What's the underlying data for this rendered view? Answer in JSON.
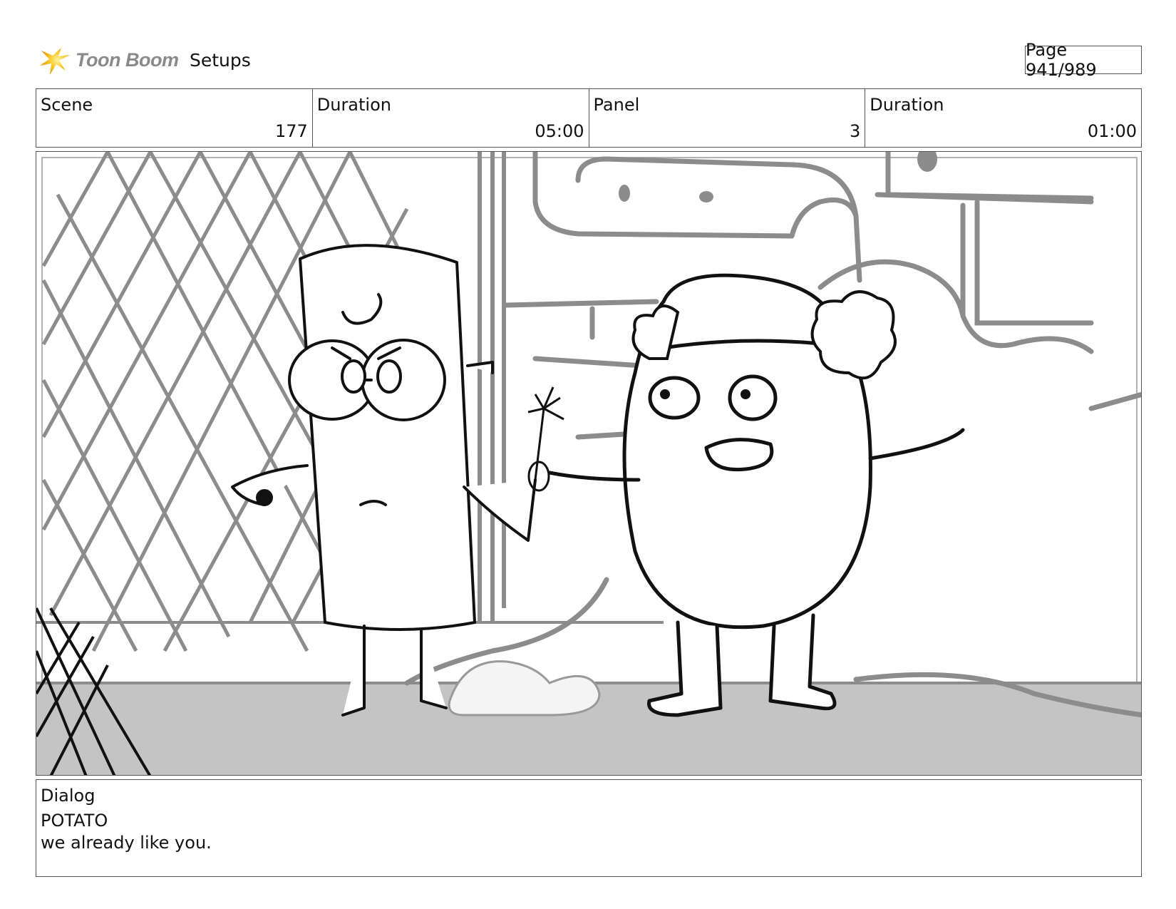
{
  "header": {
    "logo_text": "Toon Boom",
    "section": "Setups",
    "page_label": "Page 941/989"
  },
  "info": {
    "scene_label": "Scene",
    "scene_value": "177",
    "scene_duration_label": "Duration",
    "scene_duration_value": "05:00",
    "panel_label": "Panel",
    "panel_value": "3",
    "panel_duration_label": "Duration",
    "panel_duration_value": "01:00"
  },
  "panel_image": {
    "description": "storyboard-sketch",
    "colors": {
      "line": "#111111",
      "background_line": "#8c8c8c",
      "floor": "#bdbdbd"
    }
  },
  "dialog": {
    "label": "Dialog",
    "speaker": "POTATO",
    "line": "we already like you."
  }
}
